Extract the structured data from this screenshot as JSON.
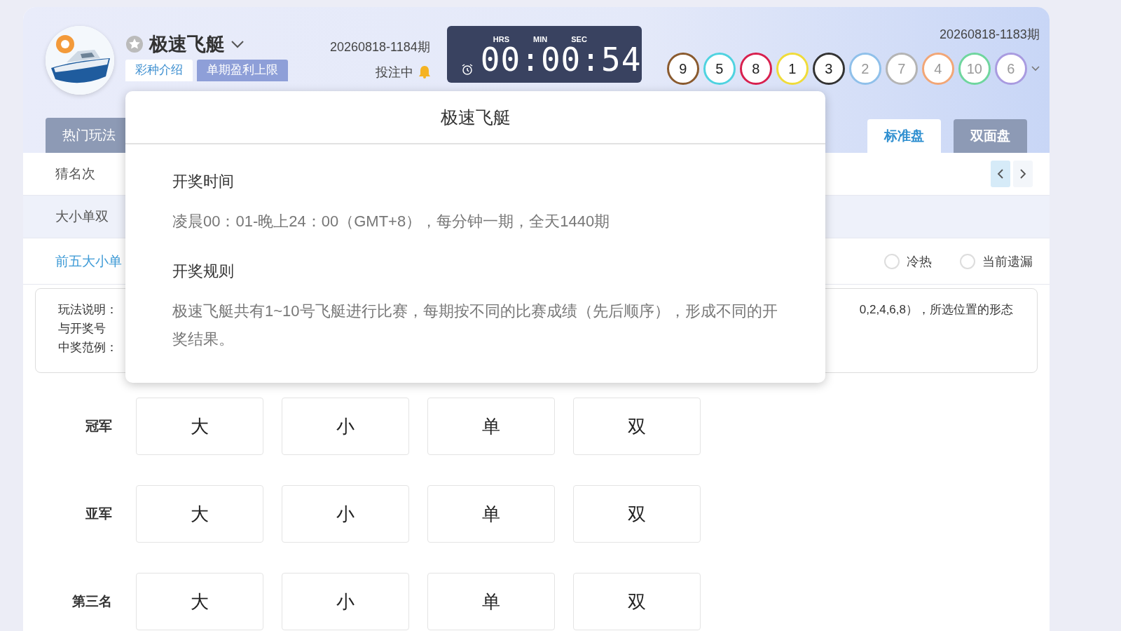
{
  "header": {
    "title": "极速飞艇",
    "info_tabs": [
      {
        "label": "彩种介绍",
        "selected": true
      },
      {
        "label": "单期盈利上限",
        "selected": false
      }
    ],
    "current_issue": "20260818-1184期",
    "status": "投注中",
    "timer": {
      "labels": [
        "HRS",
        "MIN",
        "SEC"
      ],
      "value": "00:00:54"
    },
    "last_issue": "20260818-1183期",
    "results": [
      {
        "number": "9",
        "color": "#8a5a2e",
        "highlighted": true
      },
      {
        "number": "5",
        "color": "#4fd3e0",
        "highlighted": true
      },
      {
        "number": "8",
        "color": "#d8204e",
        "highlighted": true
      },
      {
        "number": "1",
        "color": "#f0dc3a",
        "highlighted": true
      },
      {
        "number": "3",
        "color": "#333333",
        "highlighted": true
      },
      {
        "number": "2",
        "color": "#8fc0ea",
        "highlighted": false
      },
      {
        "number": "7",
        "color": "#b4b4b4",
        "highlighted": false
      },
      {
        "number": "4",
        "color": "#f2a676",
        "highlighted": false
      },
      {
        "number": "10",
        "color": "#6fd69e",
        "highlighted": false
      },
      {
        "number": "6",
        "color": "#a99be0",
        "highlighted": false
      }
    ],
    "left_tab": "热门玩法",
    "board_tabs": [
      {
        "label": "标准盘",
        "selected": true
      },
      {
        "label": "双面盘",
        "selected": false
      }
    ]
  },
  "menu_rows": [
    {
      "kind": "category",
      "label": "猜名次"
    },
    {
      "kind": "subcategory",
      "label": "大小单双"
    },
    {
      "kind": "play",
      "label": "前五大小单",
      "selected": true
    }
  ],
  "radios": [
    {
      "label": "冷热",
      "selected": false
    },
    {
      "label": "当前遗漏",
      "selected": false
    }
  ],
  "description": {
    "lines": [
      "玩法说明：",
      "与开奖号",
      "中奖范例："
    ],
    "right_fragment": "0,2,4,6,8），所选位置的形态"
  },
  "bet_rows": [
    {
      "label": "冠军",
      "options": [
        "大",
        "小",
        "单",
        "双"
      ]
    },
    {
      "label": "亚军",
      "options": [
        "大",
        "小",
        "单",
        "双"
      ]
    },
    {
      "label": "第三名",
      "options": [
        "大",
        "小",
        "单",
        "双"
      ]
    }
  ],
  "popup": {
    "title": "极速飞艇",
    "sections": [
      {
        "heading": "开奖时间",
        "text": "凌晨00：01-晚上24：00（GMT+8），每分钟一期，全天1440期"
      },
      {
        "heading": "开奖规则",
        "text": "极速飞艇共有1~10号飞艇进行比赛，每期按不同的比赛成绩（先后顺序），形成不同的开奖结果。"
      }
    ]
  }
}
